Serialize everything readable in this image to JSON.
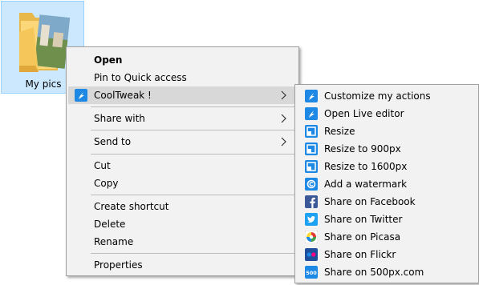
{
  "desktop": {
    "folder_label": "My pics"
  },
  "context_menu": {
    "open": "Open",
    "pin_quick_access": "Pin to Quick access",
    "cooltweak": "CoolTweak !",
    "share_with": "Share with",
    "send_to": "Send to",
    "cut": "Cut",
    "copy": "Copy",
    "create_shortcut": "Create shortcut",
    "delete": "Delete",
    "rename": "Rename",
    "properties": "Properties"
  },
  "cooltweak_submenu": {
    "items": [
      {
        "label": "Customize my actions",
        "icon": "cooltweak-icon"
      },
      {
        "label": "Open Live editor",
        "icon": "cooltweak-icon"
      },
      {
        "label": "Resize",
        "icon": "resize-icon"
      },
      {
        "label": "Resize to 900px",
        "icon": "resize-icon"
      },
      {
        "label": "Resize to 1600px",
        "icon": "resize-icon"
      },
      {
        "label": "Add a watermark",
        "icon": "watermark-icon"
      },
      {
        "label": "Share on Facebook",
        "icon": "facebook-icon"
      },
      {
        "label": "Share on Twitter",
        "icon": "twitter-icon"
      },
      {
        "label": "Share on Picasa",
        "icon": "picasa-icon"
      },
      {
        "label": "Share on Flickr",
        "icon": "flickr-icon"
      },
      {
        "label": "Share on 500px.com",
        "icon": "500px-icon"
      }
    ],
    "icon_500px_text": "500"
  },
  "colors": {
    "selection_bg": "#cce8ff",
    "selection_border": "#99d1ff",
    "menu_bg": "#f2f2f2",
    "menu_highlight": "#d8d8d8",
    "cooltweak_blue": "#1e88e5",
    "facebook_blue": "#3b5998",
    "twitter_blue": "#1da1f2",
    "flickr_pink": "#ff0084"
  }
}
